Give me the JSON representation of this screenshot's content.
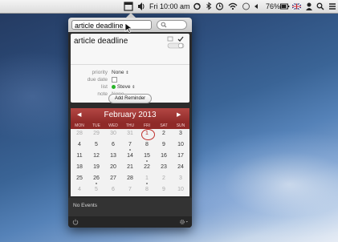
{
  "menubar": {
    "clock": "Fri 10:00 am",
    "battery": "76%"
  },
  "search": {
    "query": "article deadline"
  },
  "reminder": {
    "title": "article deadline",
    "fields": [
      {
        "label": "priority",
        "value": "None"
      },
      {
        "label": "due date",
        "value": ""
      },
      {
        "label": "list",
        "value": "Steve"
      },
      {
        "label": "note",
        "value": "None"
      }
    ],
    "list_color": "#28b428",
    "add_button": "Add Reminder"
  },
  "calendar": {
    "month": "February 2013",
    "prev": "◀",
    "next": "▶",
    "weekdays": [
      "MON",
      "TUE",
      "WED",
      "THU",
      "FRI",
      "SAT",
      "SUN"
    ],
    "weeks": [
      [
        "28",
        "29",
        "30",
        "31",
        "1",
        "2",
        "3"
      ],
      [
        "4",
        "5",
        "6",
        "7",
        "8",
        "9",
        "10"
      ],
      [
        "11",
        "12",
        "13",
        "14",
        "15",
        "16",
        "17"
      ],
      [
        "18",
        "19",
        "20",
        "21",
        "22",
        "23",
        "24"
      ],
      [
        "25",
        "26",
        "27",
        "28",
        "1",
        "2",
        "3"
      ],
      [
        "4",
        "5",
        "6",
        "7",
        "8",
        "9",
        "10"
      ]
    ],
    "today": "1",
    "accent": "#b0302c"
  },
  "footer": {
    "events_text": "No Events"
  }
}
